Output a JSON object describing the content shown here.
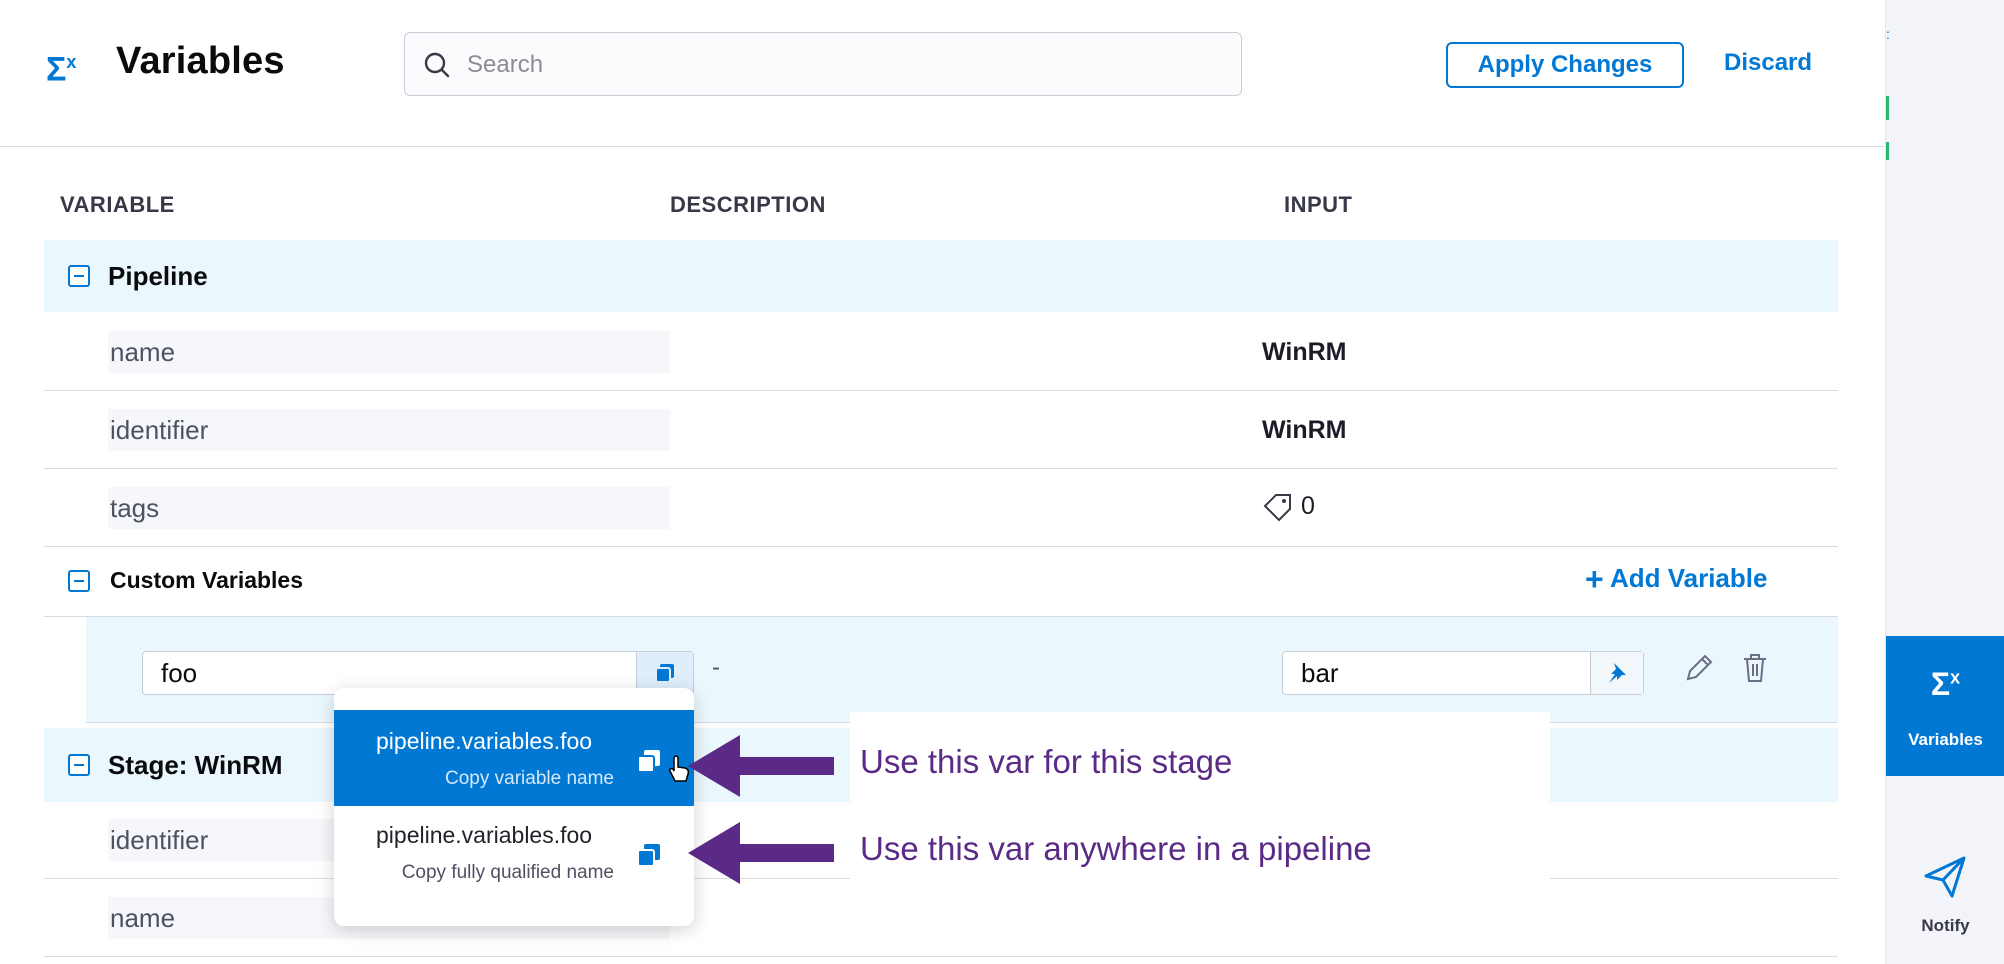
{
  "header": {
    "title_icon": "Σx",
    "title": "Variables",
    "search_placeholder": "Search",
    "apply_label": "Apply Changes",
    "discard_label": "Discard"
  },
  "columns": {
    "variable": "VARIABLE",
    "description": "DESCRIPTION",
    "input": "INPUT"
  },
  "pipeline": {
    "label": "Pipeline",
    "rows": [
      {
        "name": "name",
        "input": "WinRM"
      },
      {
        "name": "identifier",
        "input": "WinRM"
      },
      {
        "name": "tags",
        "input": "0"
      }
    ],
    "tags_icon": "tag-icon"
  },
  "custom_variables": {
    "label": "Custom Variables",
    "add_label": "Add Variable",
    "variable": {
      "name": "foo",
      "description": "-",
      "value": "bar"
    }
  },
  "stage": {
    "label": "Stage: WinRM",
    "rows": [
      {
        "name": "identifier"
      },
      {
        "name": "name"
      }
    ]
  },
  "popover": {
    "items": [
      {
        "value": "pipeline.variables.foo",
        "caption": "Copy variable name"
      },
      {
        "value": "pipeline.variables.foo",
        "caption": "Copy fully qualified name"
      }
    ]
  },
  "annotations": {
    "note1": "Use this var for this stage",
    "note2": "Use this var anywhere in a pipeline",
    "color": "#5b2a86"
  },
  "rail": {
    "variables": {
      "icon": "Σx",
      "label": "Variables"
    },
    "notify": {
      "icon": "send-icon",
      "label": "Notify"
    }
  },
  "colors": {
    "accent": "#0278d5",
    "section_bg": "#eaf8fe"
  }
}
